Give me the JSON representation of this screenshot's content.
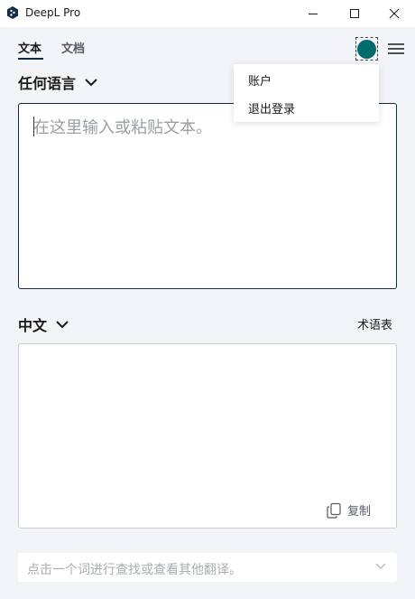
{
  "window": {
    "title": "DeepL Pro"
  },
  "tabs": [
    {
      "label": "文本",
      "active": true
    },
    {
      "label": "文档",
      "active": false
    }
  ],
  "account_menu": {
    "items": [
      {
        "label": "账户"
      },
      {
        "label": "退出登录"
      }
    ]
  },
  "source": {
    "language": "任何语言",
    "value": "",
    "placeholder": "在这里输入或粘贴文本。"
  },
  "target": {
    "language": "中文",
    "glossary_label": "术语表",
    "copy_label": "复制"
  },
  "hint": {
    "text": "点击一个词进行查找或查看其他翻译。"
  },
  "colors": {
    "accent_dark": "#0f2b46",
    "avatar": "#006b6b",
    "background": "#f3f4f7"
  },
  "icons": {
    "logo": "deepl-logo-icon",
    "minimize": "minimize-icon",
    "maximize": "maximize-icon",
    "close": "close-icon",
    "menu": "hamburger-menu-icon",
    "lang_chevron": "chevron-down-icon",
    "copy": "copy-icon"
  }
}
